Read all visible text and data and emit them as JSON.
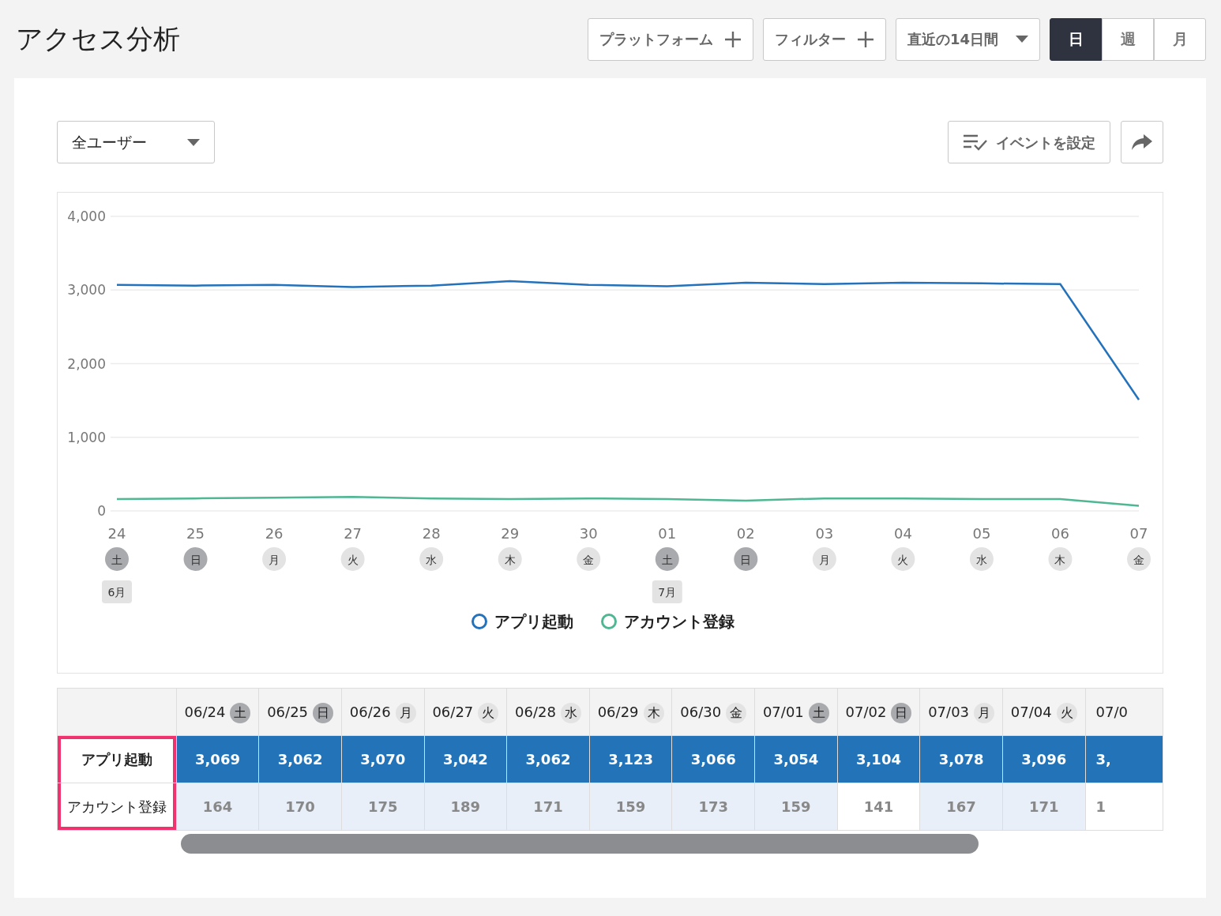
{
  "page_title": "アクセス分析",
  "toolbar": {
    "platform_button": "プラットフォーム",
    "filter_button": "フィルター",
    "period_dropdown": "直近の14日間",
    "granularity": [
      {
        "label": "日",
        "selected": true
      },
      {
        "label": "週",
        "selected": false
      },
      {
        "label": "月",
        "selected": false
      }
    ]
  },
  "segment_dropdown": "全ユーザー",
  "event_button": "イベントを設定",
  "chart": {
    "chart_data": {
      "type": "line",
      "categories": [
        "24",
        "25",
        "26",
        "27",
        "28",
        "29",
        "30",
        "01",
        "02",
        "03",
        "04",
        "05",
        "06",
        "07"
      ],
      "ylim": [
        0,
        4000
      ],
      "grid": true,
      "legend": "bottom",
      "yticks": [
        {
          "value": 0,
          "label": "0"
        },
        {
          "value": 1000,
          "label": "1,000"
        },
        {
          "value": 2000,
          "label": "2,000"
        },
        {
          "value": 3000,
          "label": "3,000"
        },
        {
          "value": 4000,
          "label": "4,000"
        }
      ],
      "series": [
        {
          "name": "アプリ起動",
          "color": "#2372bb",
          "values": [
            3070,
            3060,
            3070,
            3040,
            3060,
            3120,
            3070,
            3050,
            3100,
            3080,
            3100,
            3090,
            3080,
            1510
          ]
        },
        {
          "name": "アカウント登録",
          "color": "#4fb792",
          "values": [
            160,
            170,
            180,
            190,
            170,
            160,
            170,
            160,
            140,
            170,
            170,
            160,
            160,
            70
          ]
        }
      ]
    },
    "x_days": [
      {
        "day": "土",
        "weekend": true,
        "month": "6月"
      },
      {
        "day": "日",
        "weekend": true
      },
      {
        "day": "月",
        "weekend": false
      },
      {
        "day": "火",
        "weekend": false
      },
      {
        "day": "水",
        "weekend": false
      },
      {
        "day": "木",
        "weekend": false
      },
      {
        "day": "金",
        "weekend": false
      },
      {
        "day": "土",
        "weekend": true,
        "month": "7月"
      },
      {
        "day": "日",
        "weekend": true
      },
      {
        "day": "月",
        "weekend": false
      },
      {
        "day": "火",
        "weekend": false
      },
      {
        "day": "水",
        "weekend": false
      },
      {
        "day": "木",
        "weekend": false
      },
      {
        "day": "金",
        "weekend": false
      }
    ]
  },
  "table": {
    "label_column_highlighted": true,
    "columns": [
      {
        "date": "06/24",
        "day": "土",
        "weekend": true
      },
      {
        "date": "06/25",
        "day": "日",
        "weekend": true
      },
      {
        "date": "06/26",
        "day": "月",
        "weekend": false
      },
      {
        "date": "06/27",
        "day": "火",
        "weekend": false
      },
      {
        "date": "06/28",
        "day": "水",
        "weekend": false
      },
      {
        "date": "06/29",
        "day": "木",
        "weekend": false
      },
      {
        "date": "06/30",
        "day": "金",
        "weekend": false
      },
      {
        "date": "07/01",
        "day": "土",
        "weekend": true
      },
      {
        "date": "07/02",
        "day": "日",
        "weekend": true
      },
      {
        "date": "07/03",
        "day": "月",
        "weekend": false
      },
      {
        "date": "07/04",
        "day": "火",
        "weekend": false
      },
      {
        "date": "07/0"
      }
    ],
    "rows": [
      {
        "label": "アプリ起動",
        "kind": "primary",
        "cells": [
          {
            "value": "3,069"
          },
          {
            "value": "3,062"
          },
          {
            "value": "3,070"
          },
          {
            "value": "3,042"
          },
          {
            "value": "3,062"
          },
          {
            "value": "3,123"
          },
          {
            "value": "3,066"
          },
          {
            "value": "3,054"
          },
          {
            "value": "3,104"
          },
          {
            "value": "3,078"
          },
          {
            "value": "3,096"
          },
          {
            "value": "3,"
          }
        ]
      },
      {
        "label": "アカウント登録",
        "kind": "secondary",
        "cells": [
          {
            "value": "164",
            "shaded": true
          },
          {
            "value": "170",
            "shaded": true
          },
          {
            "value": "175",
            "shaded": true
          },
          {
            "value": "189",
            "shaded": true
          },
          {
            "value": "171",
            "shaded": true
          },
          {
            "value": "159",
            "shaded": true
          },
          {
            "value": "173",
            "shaded": true
          },
          {
            "value": "159",
            "shaded": true
          },
          {
            "value": "141",
            "shaded": false
          },
          {
            "value": "167",
            "shaded": true
          },
          {
            "value": "171",
            "shaded": true
          },
          {
            "value": "1",
            "shaded": false
          }
        ]
      }
    ]
  }
}
